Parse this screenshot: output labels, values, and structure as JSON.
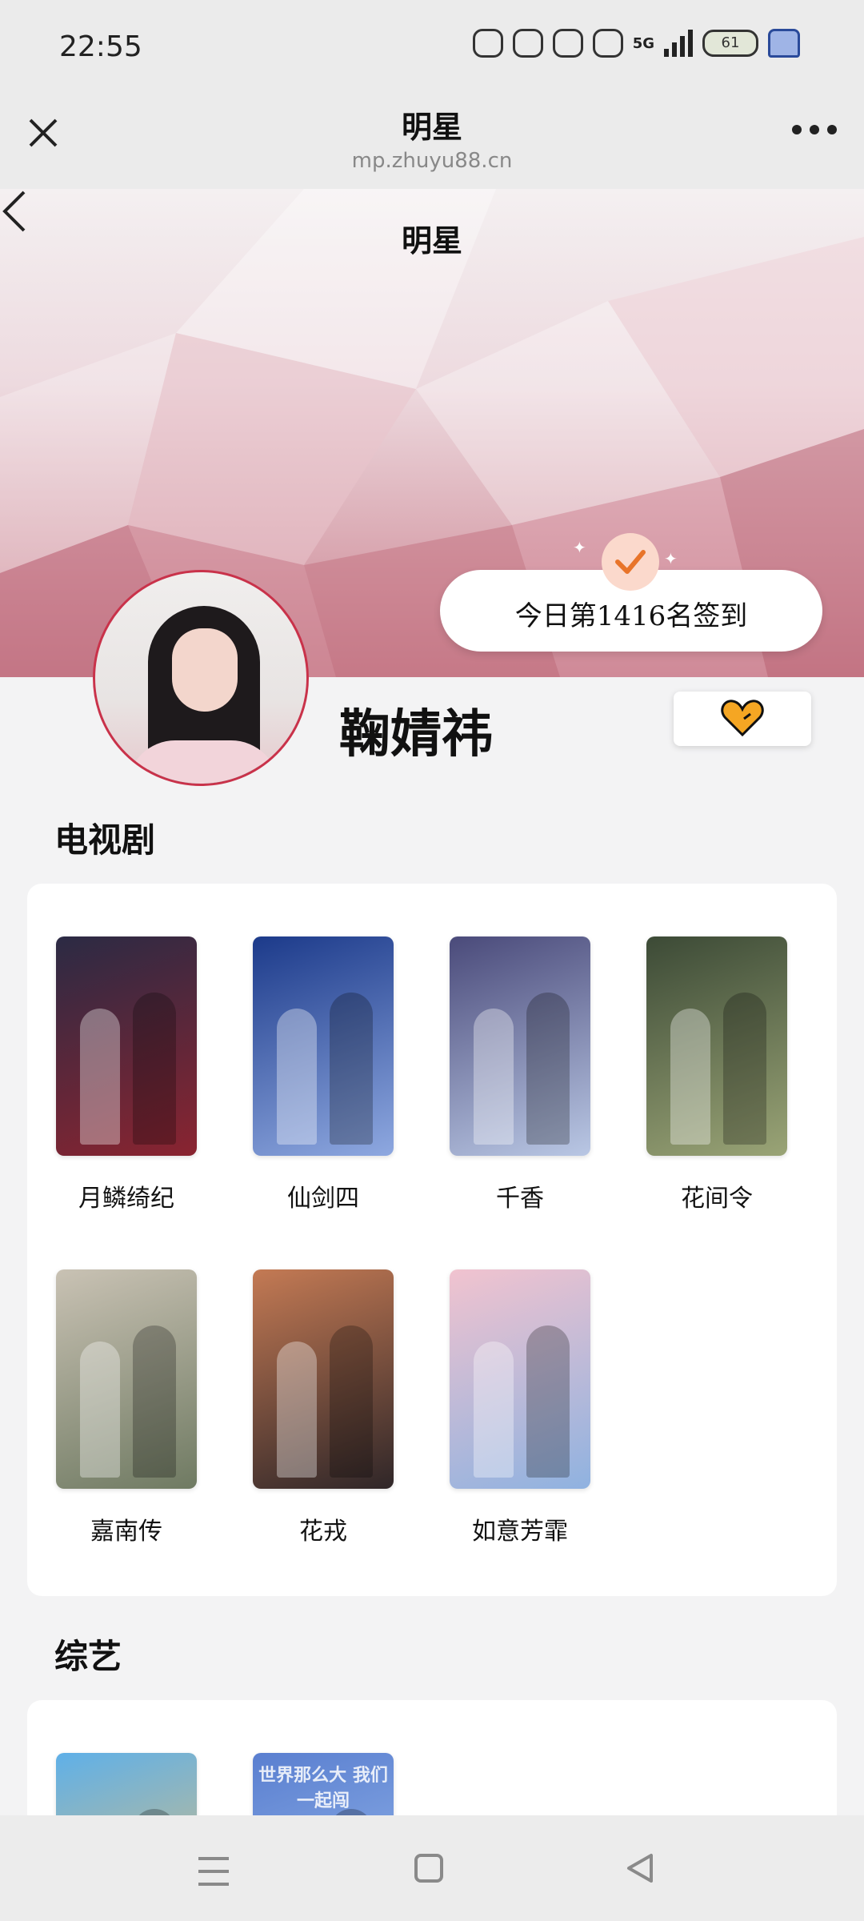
{
  "status_bar": {
    "time": "22:55",
    "network": "5G",
    "battery": "61"
  },
  "top_nav": {
    "title": "明星",
    "url": "mp.zhuyu88.cn",
    "close_icon": "close-icon",
    "more_icon": "more-dots-icon"
  },
  "page": {
    "title": "明星",
    "back_icon": "chevron-left-icon"
  },
  "checkin": {
    "text": "今日第1416名签到",
    "icon": "checkmark-icon"
  },
  "profile": {
    "name": "鞠婧祎",
    "follow_icon": "heart-icon",
    "accent": "#f5a623"
  },
  "sections": {
    "tv": {
      "title": "电视剧",
      "items": [
        {
          "label": "月鳞绮纪",
          "color_a": "#2b2a44",
          "color_b": "#8a2430"
        },
        {
          "label": "仙剑四",
          "color_a": "#1c3a8a",
          "color_b": "#8ea8e0"
        },
        {
          "label": "千香",
          "color_a": "#4a4a7a",
          "color_b": "#b9c7e4"
        },
        {
          "label": "花间令",
          "color_a": "#3c4a36",
          "color_b": "#9aa476"
        },
        {
          "label": "嘉南传",
          "color_a": "#c9c2b4",
          "color_b": "#6f7a62"
        },
        {
          "label": "花戎",
          "color_a": "#c47a54",
          "color_b": "#2f2628"
        },
        {
          "label": "如意芳霏",
          "color_a": "#f1c3cf",
          "color_b": "#8fb2e0"
        }
      ]
    },
    "variety": {
      "title": "综艺",
      "items": [
        {
          "label": "",
          "color_a": "#5fb0e8",
          "color_b": "#f2c06a"
        },
        {
          "label": "世界那么大 我们一起闯",
          "color_a": "#5a7fd0",
          "color_b": "#9fc0ee"
        }
      ]
    }
  },
  "system_nav": {
    "menu_icon": "menu-icon",
    "home_icon": "home-square-icon",
    "back_icon": "back-triangle-icon"
  }
}
